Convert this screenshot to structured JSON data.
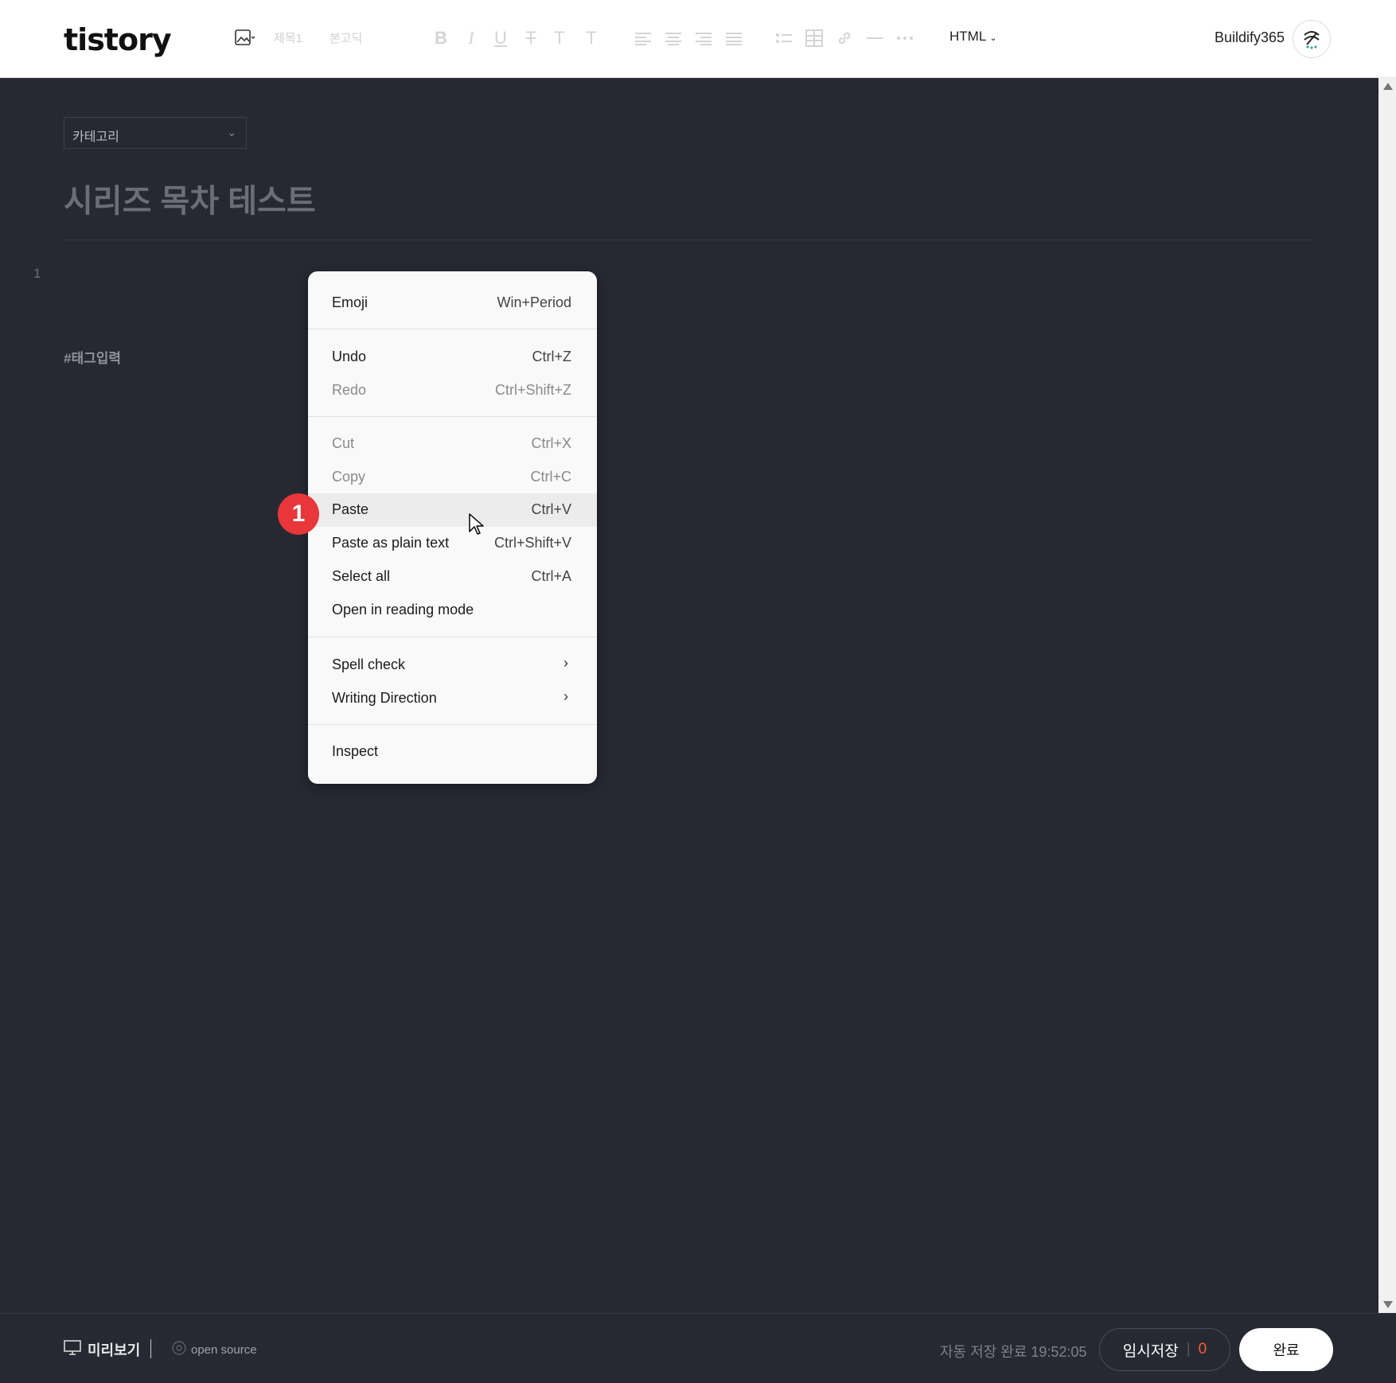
{
  "header": {
    "logo": "tistory",
    "heading_label": "제목1",
    "font_label": "본고딕",
    "mode": "HTML",
    "user": "Buildify365"
  },
  "editor": {
    "category": "카테고리",
    "title": "시리즈 목차 테스트",
    "line_number": "1",
    "tag_placeholder": "#태그입력"
  },
  "context_menu": {
    "items": [
      {
        "label": "Emoji",
        "shortcut": "Win+Period"
      },
      {
        "label": "Undo",
        "shortcut": "Ctrl+Z"
      },
      {
        "label": "Redo",
        "shortcut": "Ctrl+Shift+Z"
      },
      {
        "label": "Cut",
        "shortcut": "Ctrl+X"
      },
      {
        "label": "Copy",
        "shortcut": "Ctrl+C"
      },
      {
        "label": "Paste",
        "shortcut": "Ctrl+V"
      },
      {
        "label": "Paste as plain text",
        "shortcut": "Ctrl+Shift+V"
      },
      {
        "label": "Select all",
        "shortcut": "Ctrl+A"
      },
      {
        "label": "Open in reading mode",
        "shortcut": ""
      },
      {
        "label": "Spell check",
        "shortcut": ""
      },
      {
        "label": "Writing Direction",
        "shortcut": ""
      },
      {
        "label": "Inspect",
        "shortcut": ""
      }
    ]
  },
  "annotation": {
    "step": "1"
  },
  "footer": {
    "preview": "미리보기",
    "open_source": "open source",
    "autosave": "자동 저장 완료 19:52:05",
    "draft": "임시저장",
    "draft_count": "0",
    "done": "완료"
  },
  "colors": {
    "editor_bg": "#262932",
    "badge": "#e8363a",
    "draft_count": "#ff5a36"
  }
}
